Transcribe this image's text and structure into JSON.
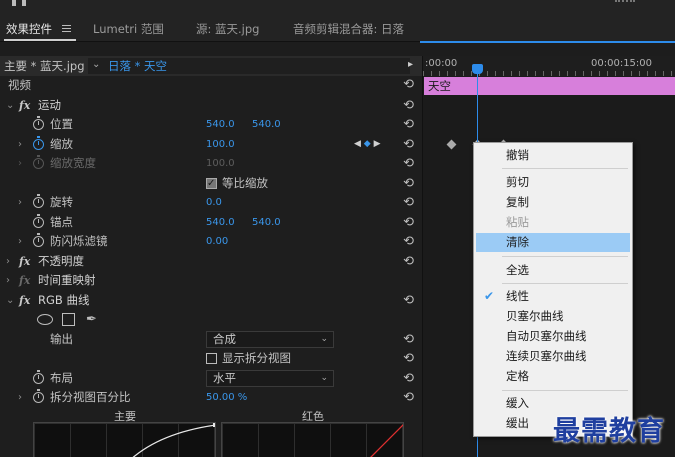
{
  "tabs": [
    {
      "label": "效果控件"
    },
    {
      "label": "Lumetri 范围"
    },
    {
      "label": "源: 蓝天.jpg"
    },
    {
      "label": "音频剪辑混合器: 日落"
    }
  ],
  "source_bar": {
    "master": "主要 * 蓝天.jpg",
    "sequence": "日落 * 天空",
    "play_arrow": "▸"
  },
  "sections": {
    "video": "视频"
  },
  "motion": {
    "title": "运动",
    "position": {
      "label": "位置",
      "x": "540.0",
      "y": "540.0"
    },
    "scale": {
      "label": "缩放",
      "value": "100.0"
    },
    "scale_width": {
      "label": "缩放宽度",
      "value": "100.0"
    },
    "uniform_scale": {
      "label": "等比缩放"
    },
    "rotation": {
      "label": "旋转",
      "value": "0.0"
    },
    "anchor": {
      "label": "锚点",
      "x": "540.0",
      "y": "540.0"
    },
    "anti_flicker": {
      "label": "防闪烁滤镜",
      "value": "0.00"
    }
  },
  "opacity": {
    "title": "不透明度"
  },
  "time_remap": {
    "title": "时间重映射"
  },
  "rgb_curves": {
    "title": "RGB 曲线",
    "output": {
      "label": "输出",
      "value": "合成"
    },
    "split_view": {
      "label": "显示拆分视图"
    },
    "layout": {
      "label": "布局",
      "value": "水平"
    },
    "split_percent": {
      "label": "拆分视图百分比",
      "value": "50.00 %"
    },
    "curve_labels": [
      "主要",
      "红色"
    ]
  },
  "timeline": {
    "tc_start": ":00:00",
    "tc_end": "00:00:15:00",
    "clip_label": "天空"
  },
  "context_menu": {
    "items": [
      {
        "label": "撤销",
        "disabled": false
      },
      {
        "label": "剪切",
        "disabled": false
      },
      {
        "label": "复制",
        "disabled": false
      },
      {
        "label": "粘贴",
        "disabled": true
      },
      {
        "label": "清除",
        "disabled": false,
        "hover": true
      },
      {
        "label": "全选",
        "disabled": false
      },
      {
        "label": "线性",
        "disabled": false,
        "checked": true
      },
      {
        "label": "贝塞尔曲线",
        "disabled": false
      },
      {
        "label": "自动贝塞尔曲线",
        "disabled": false
      },
      {
        "label": "连续贝塞尔曲线",
        "disabled": false
      },
      {
        "label": "定格",
        "disabled": false
      },
      {
        "label": "缓入",
        "disabled": false
      },
      {
        "label": "缓出",
        "disabled": false
      }
    ]
  },
  "watermark": "最需教育",
  "colors": {
    "accent": "#2d8ceb",
    "clip": "#d77fdb",
    "value_blue": "#3a96ea"
  },
  "icons": [
    "stopwatch-icon",
    "reset-icon",
    "fx-icon",
    "ellipse-mask-icon",
    "rectangle-mask-icon",
    "pen-mask-icon",
    "keyframe-icon",
    "checkmark-icon"
  ]
}
